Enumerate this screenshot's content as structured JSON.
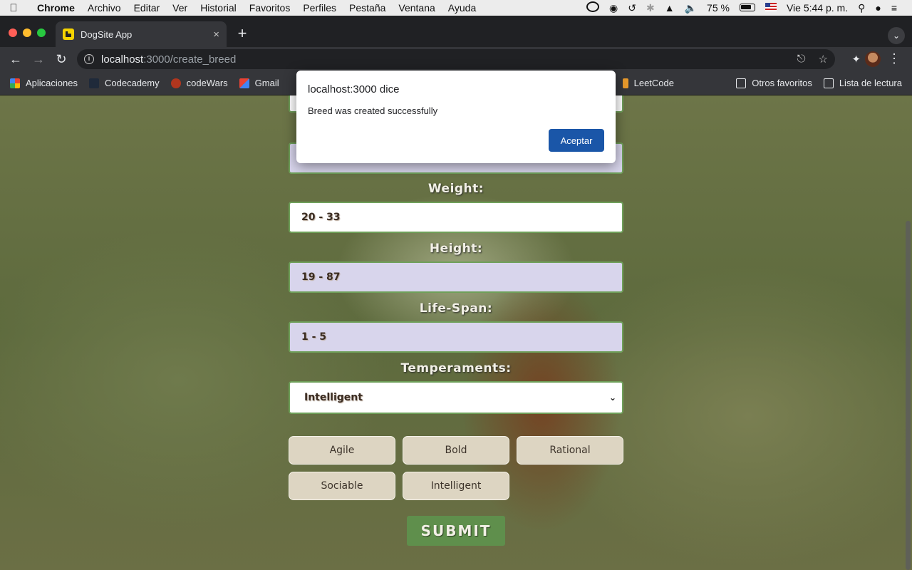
{
  "menubar": {
    "app": "Chrome",
    "items": [
      "Archivo",
      "Editar",
      "Ver",
      "Historial",
      "Favoritos",
      "Perfiles",
      "Pestaña",
      "Ventana",
      "Ayuda"
    ],
    "battery": "75 %",
    "clock": "Vie 5:44 p. m."
  },
  "tab": {
    "title": "DogSite App",
    "close": "×",
    "new": "+"
  },
  "toolbar": {
    "url_host": "localhost",
    "url_path": ":3000/create_breed"
  },
  "bookmarks": {
    "left": [
      "Aplicaciones",
      "Codecademy",
      "codeWars",
      "Gmail"
    ],
    "leetcode": "LeetCode",
    "right": [
      "Otros favoritos",
      "Lista de lectura"
    ]
  },
  "form": {
    "weight_label": "Weight:",
    "weight_value": "20 - 33",
    "height_label": "Height:",
    "height_value": "19 - 87",
    "lifespan_label": "Life-Span:",
    "lifespan_value": "1 - 5",
    "temperaments_label": "Temperaments:",
    "temperaments_selected": "Intelligent",
    "chips": [
      "Agile",
      "Bold",
      "Rational",
      "Sociable",
      "Intelligent"
    ],
    "submit": "SUBMIT"
  },
  "dialog": {
    "title": "localhost:3000 dice",
    "message": "Breed was created successfully",
    "button": "Aceptar"
  }
}
